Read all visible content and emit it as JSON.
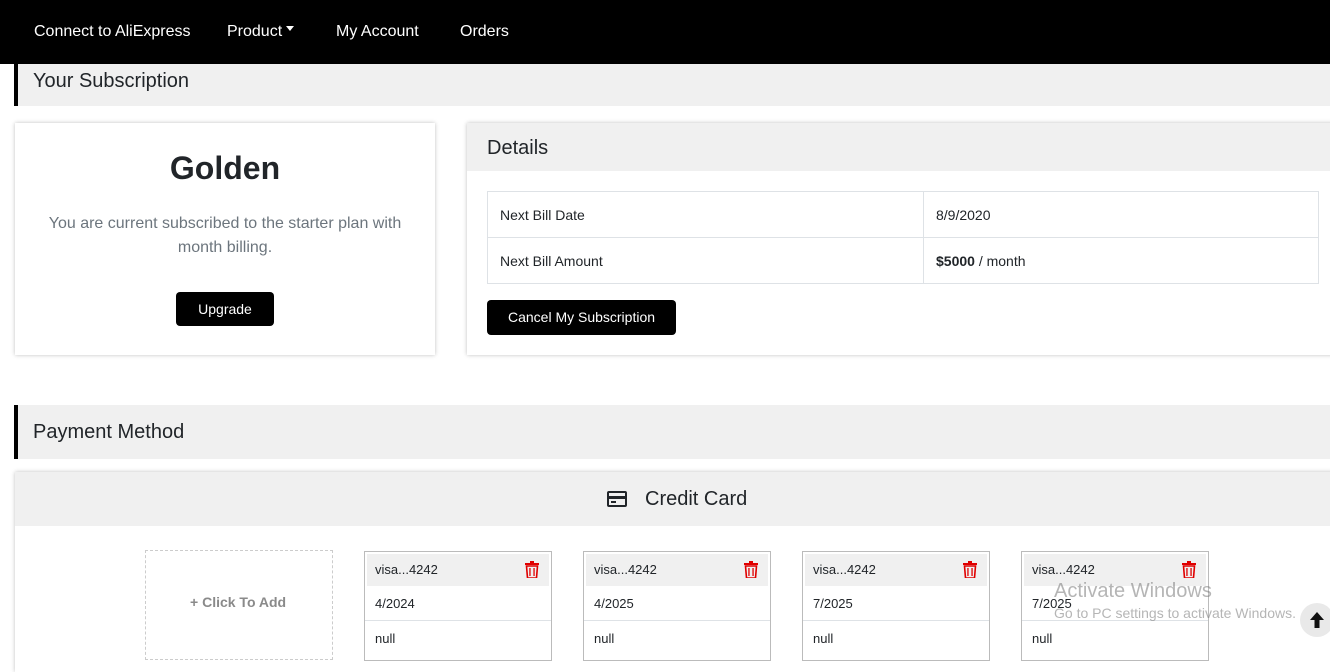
{
  "nav": {
    "items": [
      {
        "label": "Connect to AliExpress"
      },
      {
        "label": "Product"
      },
      {
        "label": "My Account"
      },
      {
        "label": "Orders"
      }
    ]
  },
  "subscription": {
    "section_title": "Your Subscription",
    "plan_name": "Golden",
    "plan_description": "You are current subscribed to the starter plan with month billing.",
    "upgrade_label": "Upgrade",
    "details_title": "Details",
    "rows": [
      {
        "label": "Next Bill Date",
        "value": "8/9/2020"
      },
      {
        "label": "Next Bill Amount",
        "amount": "$5000",
        "period": " / month"
      }
    ],
    "cancel_label": "Cancel My Subscription"
  },
  "payment": {
    "section_title": "Payment Method",
    "credit_card_title": "Credit Card",
    "add_label": "Click To Add",
    "cards": [
      {
        "number": "visa...4242",
        "expiry": "4/2024",
        "name": "null"
      },
      {
        "number": "visa...4242",
        "expiry": "4/2025",
        "name": "null"
      },
      {
        "number": "visa...4242",
        "expiry": "7/2025",
        "name": "null"
      },
      {
        "number": "visa...4242",
        "expiry": "7/2025",
        "name": "null"
      }
    ]
  },
  "watermark": {
    "line1": "Activate Windows",
    "line2": "Go to PC settings to activate Windows."
  },
  "colors": {
    "accent": "#000000",
    "danger": "#e00000",
    "header_bg": "#f0f0f0"
  }
}
